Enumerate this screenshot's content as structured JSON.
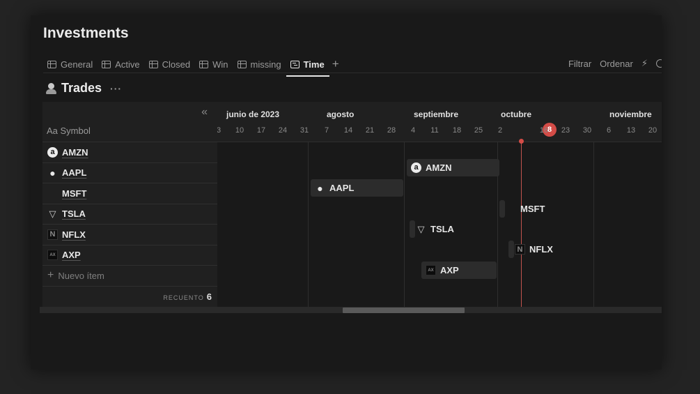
{
  "page": {
    "title": "Investments"
  },
  "tabs": [
    {
      "label": "General",
      "icon": "table-icon",
      "active": false
    },
    {
      "label": "Active",
      "icon": "table-icon",
      "active": false
    },
    {
      "label": "Closed",
      "icon": "table-icon",
      "active": false
    },
    {
      "label": "Win",
      "icon": "table-icon",
      "active": false
    },
    {
      "label": "missing",
      "icon": "table-icon",
      "active": false
    },
    {
      "label": "Time",
      "icon": "timeline-icon",
      "active": true
    }
  ],
  "toolbar": {
    "add_view": "+",
    "filter": "Filtrar",
    "sort": "Ordenar",
    "automation_icon": "lightning-icon",
    "search_icon": "search-icon"
  },
  "database": {
    "title": "Trades",
    "icon": "person-icon",
    "more": "···"
  },
  "table": {
    "collapse": "«",
    "column_header": "Aa Symbol",
    "rows": [
      {
        "symbol": "AMZN",
        "logo": "amazon-logo"
      },
      {
        "symbol": "AAPL",
        "logo": "apple-logo"
      },
      {
        "symbol": "MSFT",
        "logo": "microsoft-logo"
      },
      {
        "symbol": "TSLA",
        "logo": "tesla-logo"
      },
      {
        "symbol": "NFLX",
        "logo": "netflix-logo"
      },
      {
        "symbol": "AXP",
        "logo": "amex-logo"
      }
    ],
    "new_item": "Nuevo ítem",
    "count_label": "RECUENTO",
    "count_value": "6"
  },
  "timeline": {
    "months": [
      "junio de 2023",
      "agosto",
      "septiembre",
      "octubre",
      "noviembre"
    ],
    "days": [
      "3",
      "10",
      "17",
      "24",
      "31",
      "7",
      "14",
      "21",
      "28",
      "4",
      "11",
      "18",
      "25",
      "2",
      "8",
      "16",
      "23",
      "30",
      "6",
      "13",
      "20"
    ],
    "today": "8",
    "colors": {
      "today": "#d44c47",
      "background": "#191919"
    }
  }
}
